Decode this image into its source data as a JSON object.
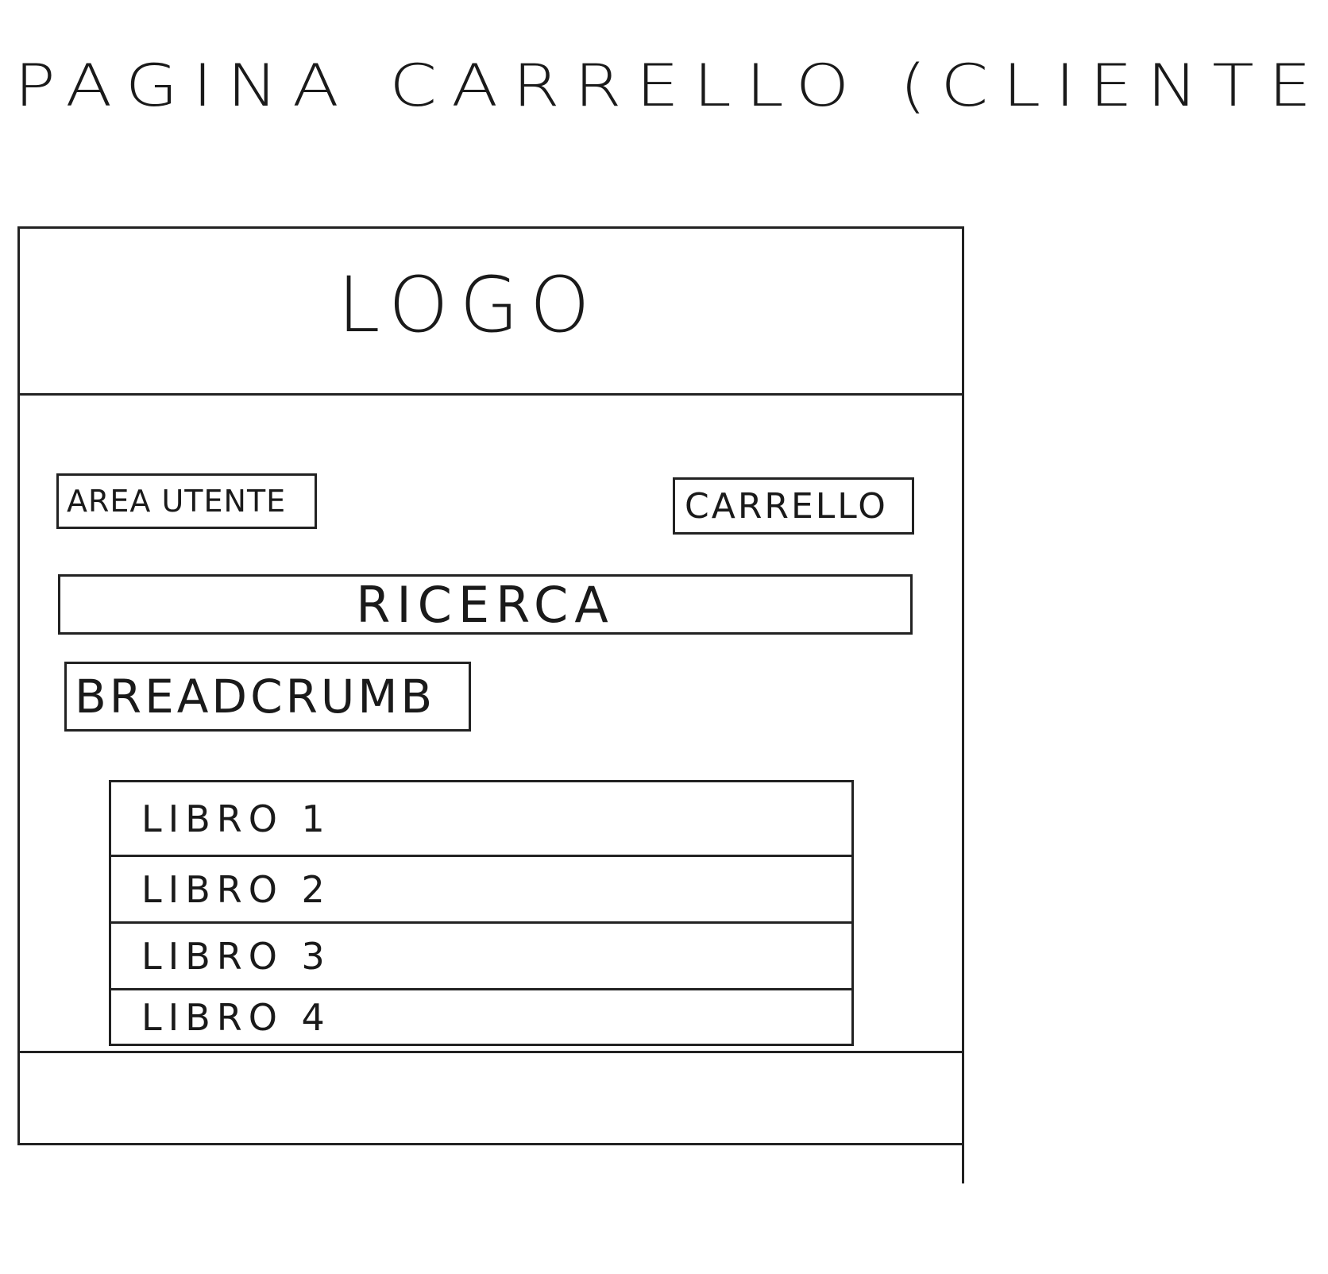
{
  "sheet_title": "PAGINA CARRELLO (CLIENTE)",
  "header": {
    "logo": "LOGO"
  },
  "nav": {
    "user_area_label": "AREA UTENTE",
    "cart_label": "CARRELLO"
  },
  "search": {
    "label": "RICERCA"
  },
  "breadcrumb": {
    "label": "BREADCRUMB"
  },
  "cart": {
    "items": [
      {
        "label": "LIBRO 1"
      },
      {
        "label": "LIBRO 2"
      },
      {
        "label": "LIBRO 3"
      },
      {
        "label": "LIBRO 4"
      }
    ]
  }
}
